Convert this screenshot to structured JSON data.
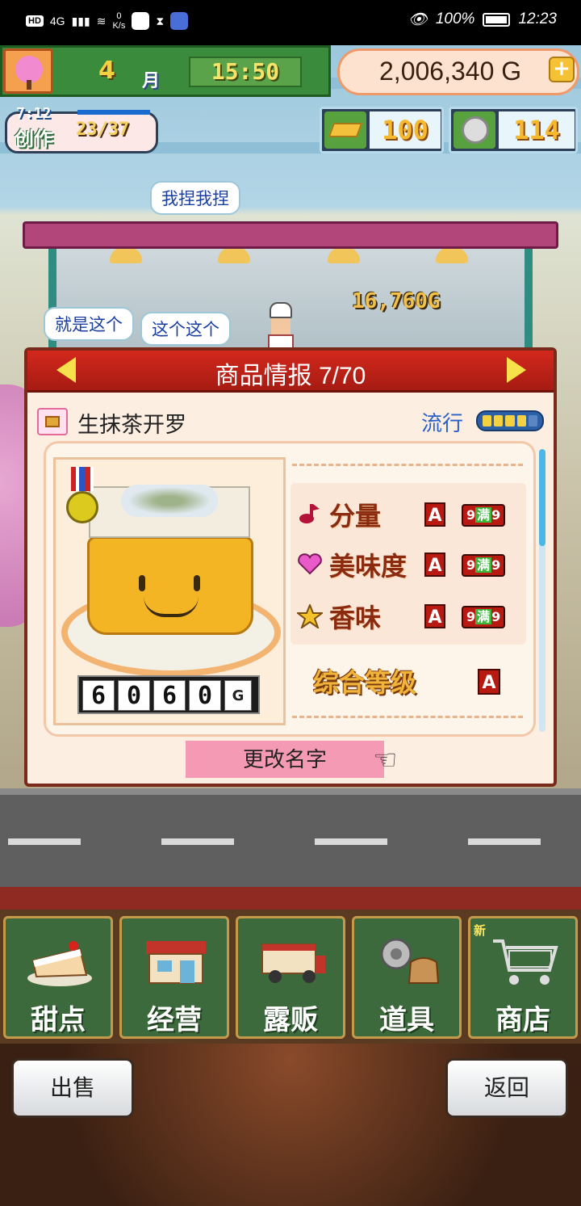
{
  "status_bar": {
    "network_hd": "HD",
    "network_type": "4G",
    "speed_value": "0",
    "speed_unit": "K/s",
    "battery_percent": "100%",
    "time": "12:23"
  },
  "hud": {
    "month_number": "4",
    "month_unit": "月",
    "clock": "15:50",
    "money": "2,006,340 G",
    "money_add": "+",
    "create_timer": "7:12",
    "create_label": "创作",
    "create_count": "23/37",
    "gold_count": "100",
    "medal_count": "114"
  },
  "scene": {
    "bubbles": [
      "我捏我捏",
      "就是这个",
      "这个这个"
    ],
    "floating_income": "16,760G"
  },
  "panel": {
    "title": "商品情报 7/70",
    "item_name": "生抹茶开罗",
    "trend_label": "流行",
    "trend_level": 4,
    "trend_max": 5,
    "price_digits": [
      "6",
      "0",
      "6",
      "0"
    ],
    "price_unit": "G",
    "stats": [
      {
        "icon": "music-note-icon",
        "label": "分量",
        "grade": "A",
        "max": "满"
      },
      {
        "icon": "heart-icon",
        "label": "美味度",
        "grade": "A",
        "max": "满"
      },
      {
        "icon": "star-icon",
        "label": "香味",
        "grade": "A",
        "max": "满"
      }
    ],
    "overall_label": "综合等级",
    "overall_grade": "A",
    "rename_label": "更改名字"
  },
  "nav": {
    "items": [
      {
        "label": "甜点",
        "icon": "cake-icon"
      },
      {
        "label": "经营",
        "icon": "shop-icon"
      },
      {
        "label": "露贩",
        "icon": "food-truck-icon"
      },
      {
        "label": "道具",
        "icon": "items-icon"
      },
      {
        "label": "商店",
        "icon": "cart-icon",
        "badge": "新"
      }
    ]
  },
  "footer": {
    "sell_label": "出售",
    "back_label": "返回"
  },
  "colors": {
    "panel_header": "#c1241a",
    "accent_pink": "#f49ab4",
    "grade_red": "#b81a12",
    "trend_blue": "#2a61c8"
  }
}
